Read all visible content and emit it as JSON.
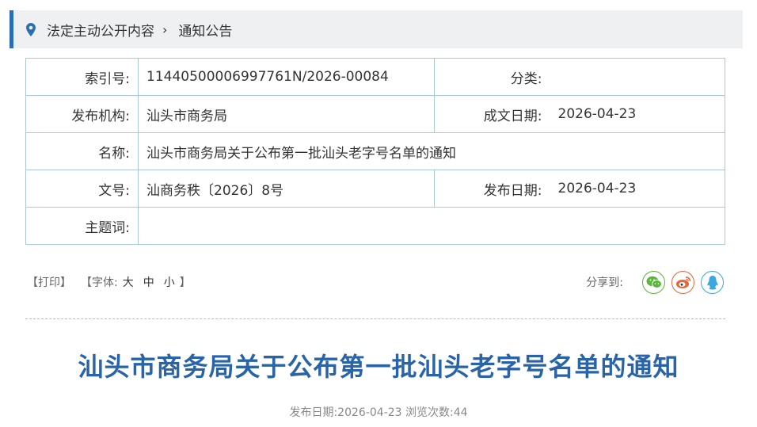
{
  "breadcrumb": {
    "level1": "法定主动公开内容",
    "separator": "›",
    "level2": "通知公告"
  },
  "meta": {
    "index_label": "索引号:",
    "index_value": "11440500006997761N/2026-00084",
    "category_label": "分类:",
    "category_value": "",
    "org_label": "发布机构:",
    "org_value": "汕头市商务局",
    "created_label": "成文日期:",
    "created_value": "2026-04-23",
    "name_label": "名称:",
    "name_value": "汕头市商务局关于公布第一批汕头老字号名单的通知",
    "docno_label": "文号:",
    "docno_value": "汕商务秩〔2026〕8号",
    "pubdate_label": "发布日期:",
    "pubdate_value": "2026-04-23",
    "keywords_label": "主题词:",
    "keywords_value": ""
  },
  "tools": {
    "print": "【打印】",
    "font_prefix": "【字体:",
    "font_large": "大",
    "font_medium": "中",
    "font_small": "小",
    "font_suffix": "】",
    "share_label": "分享到:"
  },
  "share_icons": [
    "wechat-icon",
    "weibo-icon",
    "qq-icon"
  ],
  "colors": {
    "accent": "#2a6fb5",
    "title": "#2a64a8",
    "wechat": "#5db43f",
    "weibo": "#e06a3b",
    "qq": "#3da7e0"
  },
  "article": {
    "title": "汕头市商务局关于公布第一批汕头老字号名单的通知",
    "info": "发布日期:2026-04-23 浏览次数:44"
  }
}
